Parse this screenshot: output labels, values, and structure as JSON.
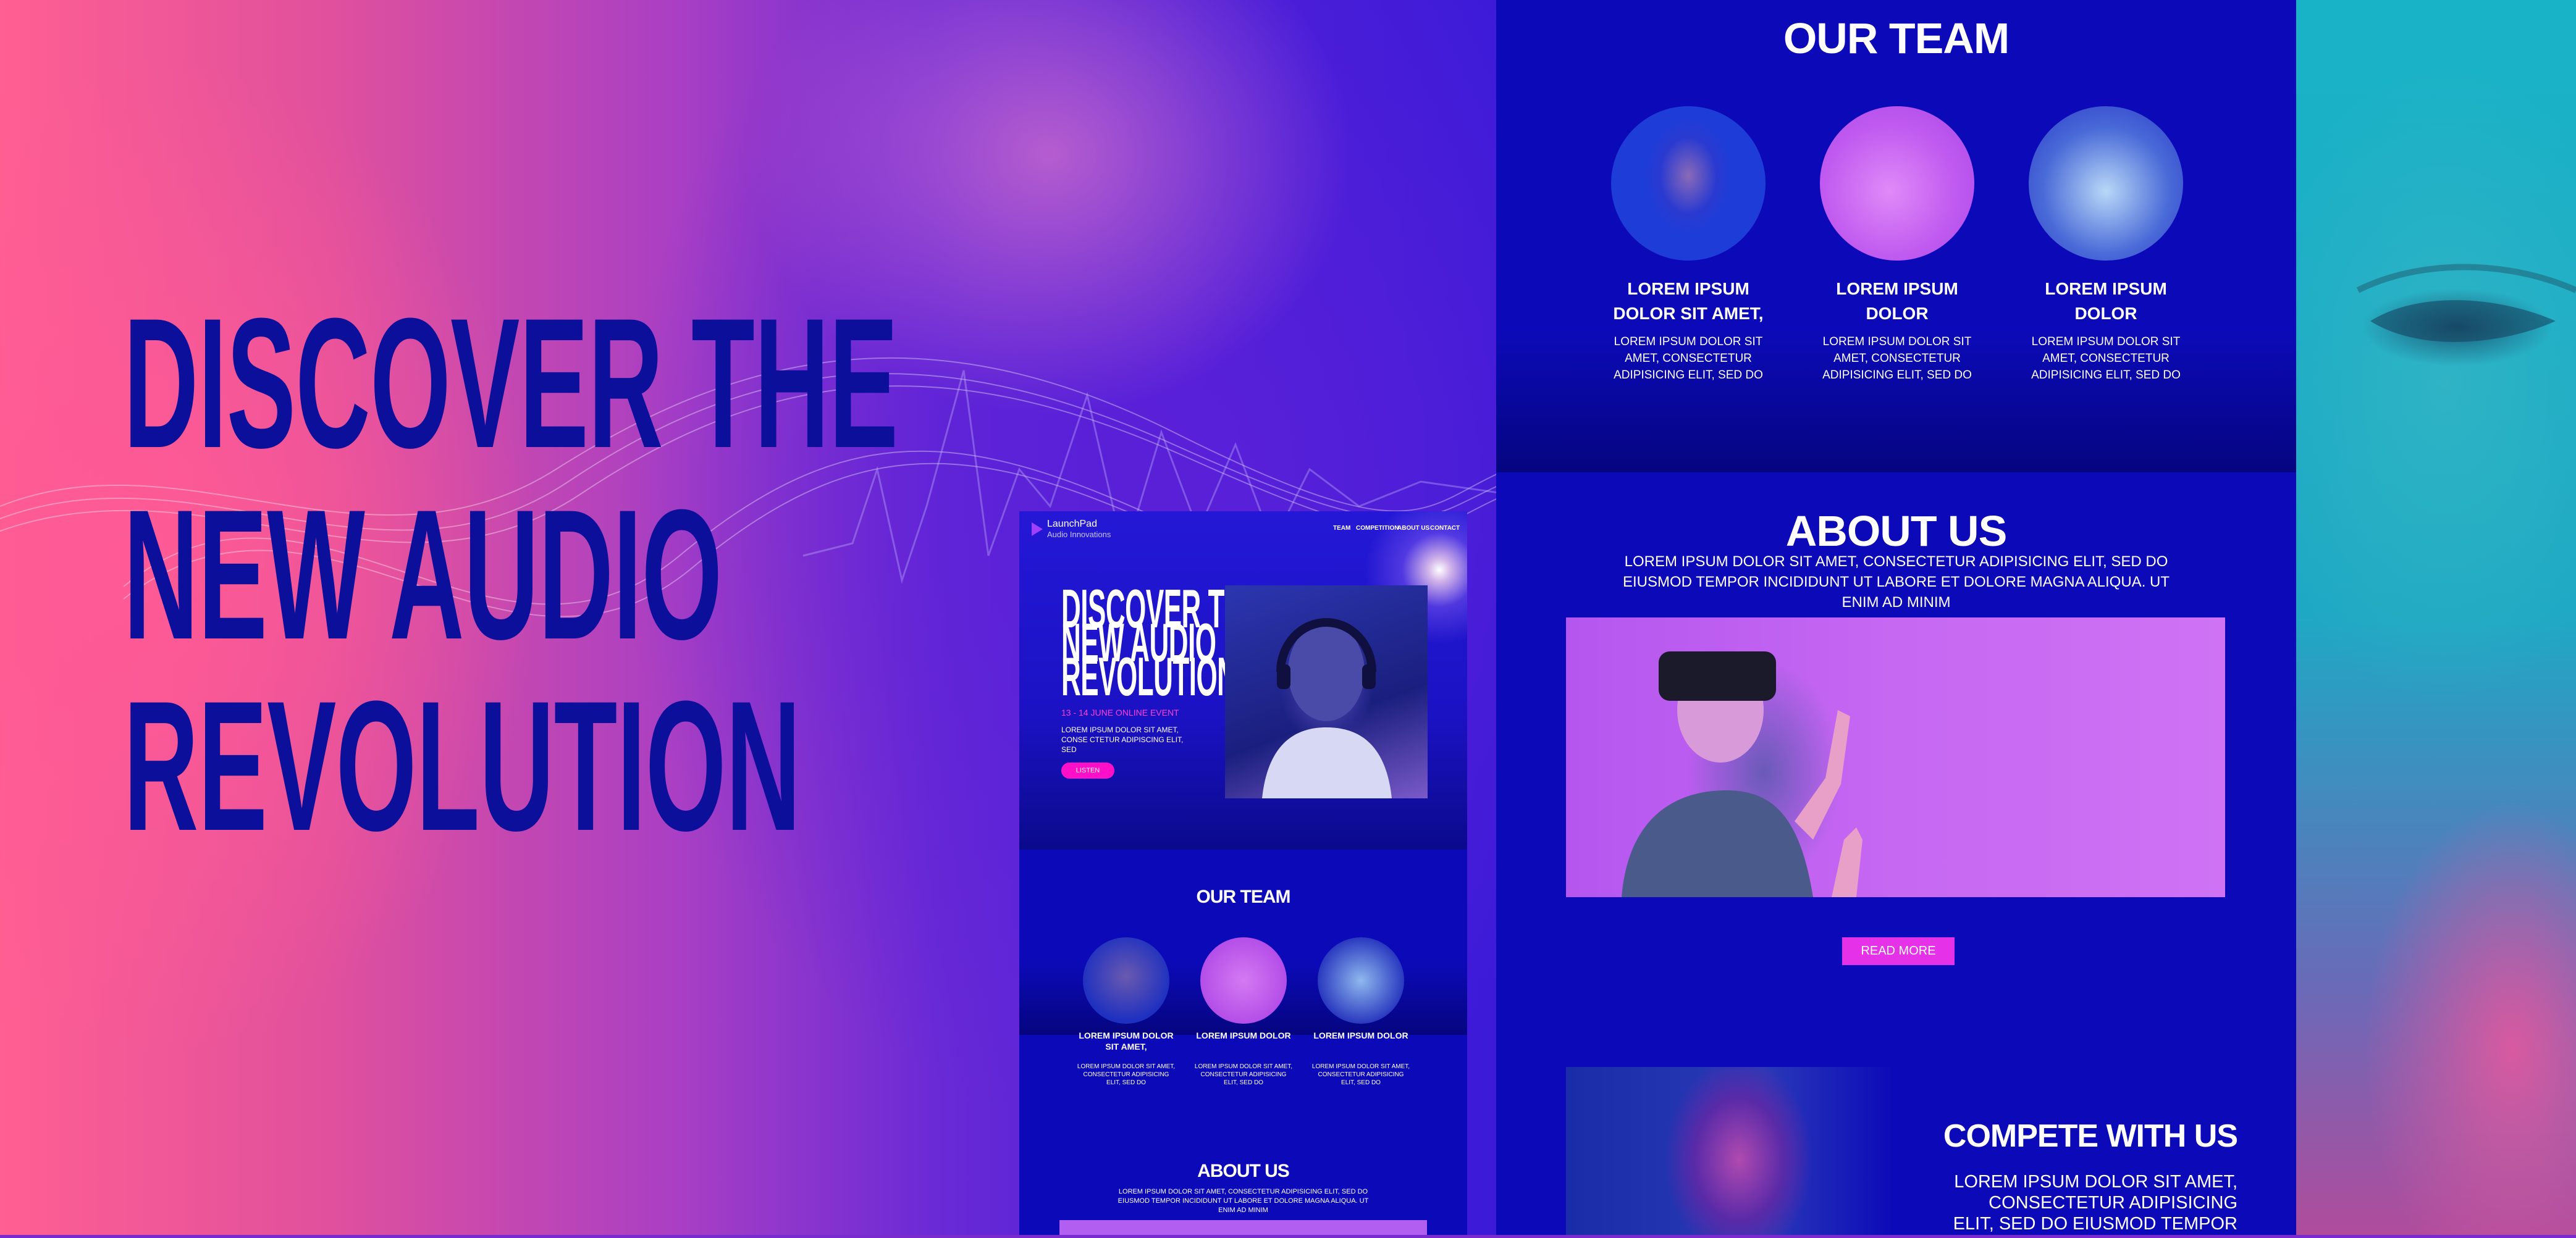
{
  "hero": {
    "title": "DISCOVER THE NEW AUDIO REVOLUTION"
  },
  "mini_site": {
    "logo": {
      "name": "LaunchPad",
      "sub": "Audio Innovations"
    },
    "nav": [
      "TEAM",
      "COMPETITION",
      "ABOUT US",
      "CONTACT"
    ],
    "hero_title": "DISCOVER THE NEW AUDIO REVOLUTION",
    "event": "13 - 14 JUNE ONLINE EVENT",
    "description": "LOREM IPSUM DOLOR SIT AMET, CONSE CTETUR ADIPISCING ELIT, SED",
    "listen_label": "LISTEN",
    "team_heading": "OUR TEAM",
    "team": [
      {
        "name": "LOREM IPSUM DOLOR SIT AMET,",
        "text": "LOREM IPSUM DOLOR SIT AMET, CONSECTETUR ADIPISICING ELIT, SED DO"
      },
      {
        "name": "LOREM IPSUM DOLOR",
        "text": "LOREM IPSUM DOLOR SIT AMET, CONSECTETUR ADIPISICING ELIT, SED DO"
      },
      {
        "name": "LOREM IPSUM DOLOR",
        "text": "LOREM IPSUM DOLOR SIT AMET, CONSECTETUR ADIPISICING ELIT, SED DO"
      }
    ],
    "about_heading": "ABOUT US",
    "about_text": "LOREM IPSUM DOLOR SIT AMET, CONSECTETUR ADIPISICING ELIT, SED DO EIUSMOD TEMPOR INCIDIDUNT UT LABORE ET DOLORE MAGNA ALIQUA. UT ENIM AD MINIM"
  },
  "big_site": {
    "team_heading": "OUR TEAM",
    "team": [
      {
        "name": "LOREM IPSUM DOLOR SIT AMET,",
        "text": "LOREM IPSUM DOLOR SIT AMET, CONSECTETUR ADIPISICING ELIT, SED DO"
      },
      {
        "name": "LOREM IPSUM DOLOR",
        "text": "LOREM IPSUM DOLOR SIT AMET, CONSECTETUR ADIPISICING ELIT, SED DO"
      },
      {
        "name": "LOREM IPSUM DOLOR",
        "text": "LOREM IPSUM DOLOR SIT AMET, CONSECTETUR ADIPISICING ELIT, SED DO"
      }
    ],
    "about_heading": "ABOUT US",
    "about_text": "LOREM IPSUM DOLOR SIT AMET, CONSECTETUR ADIPISICING ELIT, SED DO EIUSMOD TEMPOR INCIDIDUNT UT LABORE ET DOLORE MAGNA ALIQUA. UT ENIM AD MINIM",
    "read_more_label": "READ MORE",
    "compete_heading": "COMPETE WITH US",
    "compete_text": "LOREM IPSUM DOLOR SIT AMET, CONSECTETUR ADIPISICING ELIT, SED DO EIUSMOD TEMPOR INCIDIDUNT UT"
  },
  "colors": {
    "title_navy": "#0b0f9a",
    "site_blue": "#0c0ab8",
    "accent_pink": "#ff10c8",
    "button_magenta": "#e531e8"
  }
}
